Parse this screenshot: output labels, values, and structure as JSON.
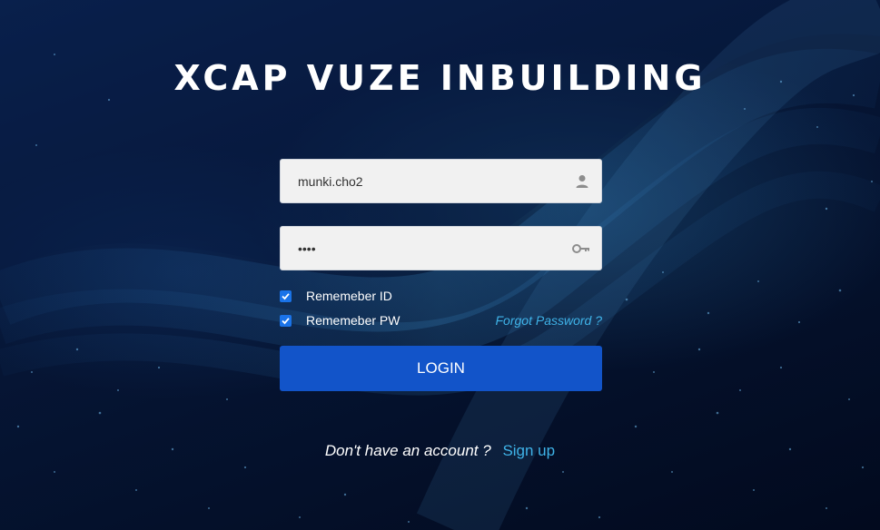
{
  "app": {
    "title": "XCAP VUZE INBUILDING"
  },
  "login_form": {
    "username": {
      "value": "munki.cho2",
      "icon": "user-icon"
    },
    "password": {
      "value": "1234",
      "icon": "key-icon"
    },
    "remember_id": {
      "label": "Rememeber ID",
      "checked": true
    },
    "remember_pw": {
      "label": "Rememeber PW",
      "checked": true
    },
    "forgot_password_label": "Forgot Password ?",
    "login_label": "LOGIN"
  },
  "signup": {
    "prompt": "Don't have an account ?",
    "link_label": "Sign up"
  },
  "colors": {
    "accent": "#1254c9",
    "link": "#3fb3e8",
    "checkbox": "#1a73e8",
    "background": "#030e26"
  }
}
